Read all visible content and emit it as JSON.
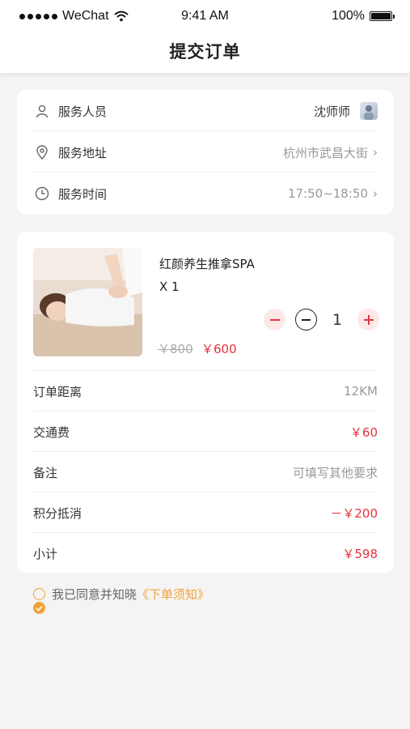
{
  "status_bar": {
    "carrier": "WeChat",
    "time": "9:41 AM",
    "battery": "100%"
  },
  "header": {
    "title": "提交订单"
  },
  "service": {
    "staff_label": "服务人员",
    "staff_value": "沈师师",
    "address_label": "服务地址",
    "address_value": "杭州市武昌大街",
    "time_label": "服务时间",
    "time_value": "17:50~18:50"
  },
  "product": {
    "name": "红颜养生推拿SPA",
    "count_text": "X 1",
    "quantity": "1",
    "price_old": "￥800",
    "price_new": "￥600"
  },
  "details": {
    "distance_label": "订单距离",
    "distance_value": "12KM",
    "traffic_label": "交通费",
    "traffic_value": "￥60",
    "note_label": "备注",
    "note_placeholder": "可填写其他要求",
    "points_label": "积分抵消",
    "points_value": "－￥200",
    "subtotal_label": "小计",
    "subtotal_value": "￥598"
  },
  "agreement": {
    "text": "我已同意并知晓",
    "link": "《下单须知》"
  },
  "colors": {
    "accent_red": "#e8323c",
    "accent_orange": "#f0a23a"
  }
}
